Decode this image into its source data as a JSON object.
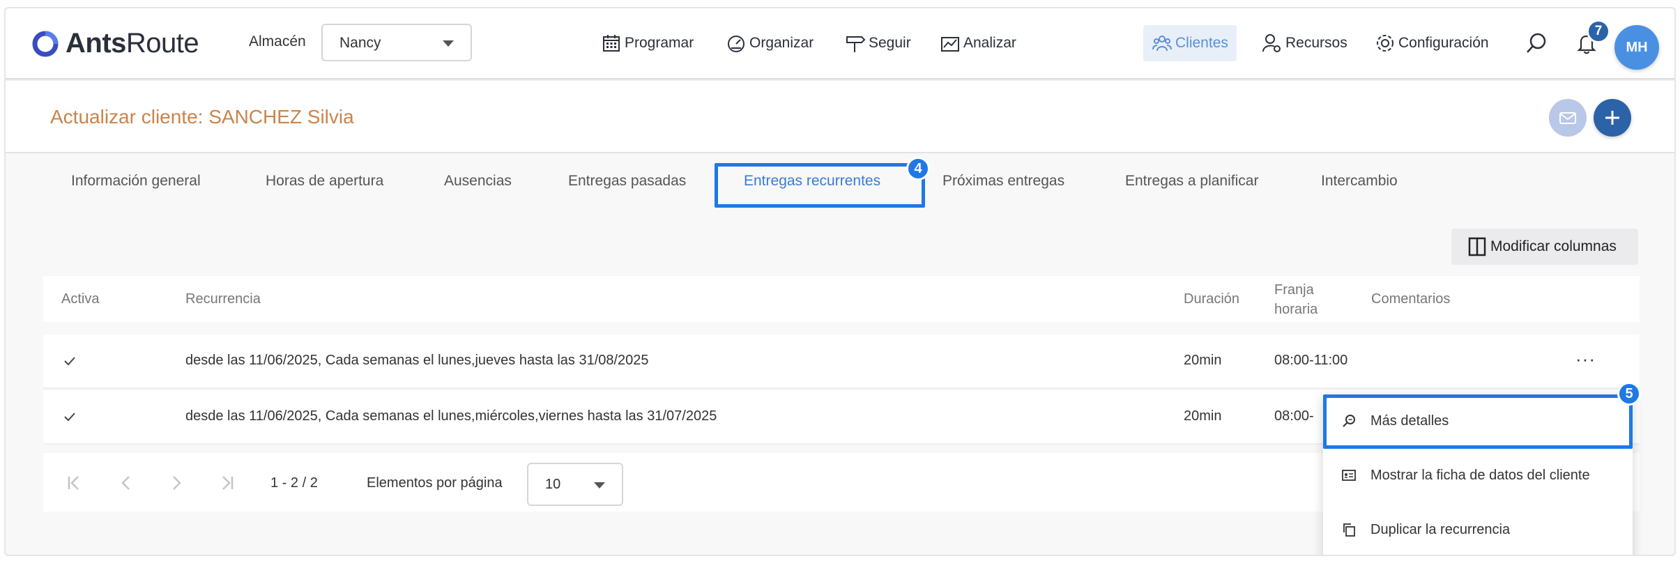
{
  "header": {
    "logo": {
      "bold": "Ants",
      "light": "Route"
    },
    "warehouse_label": "Almacén",
    "warehouse_value": "Nancy",
    "nav": [
      {
        "label": "Programar",
        "icon": "calendar-icon"
      },
      {
        "label": "Organizar",
        "icon": "gauge-icon"
      },
      {
        "label": "Seguir",
        "icon": "signpost-icon"
      },
      {
        "label": "Analizar",
        "icon": "chart-icon"
      },
      {
        "label": "Clientes",
        "icon": "people-icon",
        "active": true
      },
      {
        "label": "Recursos",
        "icon": "user-gear-icon"
      },
      {
        "label": "Configuración",
        "icon": "gear-icon"
      }
    ],
    "notification_count": "7",
    "avatar_initials": "MH"
  },
  "page": {
    "title": "Actualizar cliente: SANCHEZ Silvia"
  },
  "tabs": [
    {
      "label": "Información general"
    },
    {
      "label": "Horas de apertura"
    },
    {
      "label": "Ausencias"
    },
    {
      "label": "Entregas pasadas"
    },
    {
      "label": "Entregas recurrentes",
      "active": true
    },
    {
      "label": "Próximas entregas"
    },
    {
      "label": "Entregas a planificar"
    },
    {
      "label": "Intercambio"
    }
  ],
  "annotations": {
    "tab_step": "4",
    "menu_step": "5"
  },
  "toolbar": {
    "columns_button": "Modificar columnas"
  },
  "table": {
    "headers": {
      "activa": "Activa",
      "recurrencia": "Recurrencia",
      "duracion": "Duración",
      "franja_line1": "Franja",
      "franja_line2": "horaria",
      "comentarios": "Comentarios"
    },
    "rows": [
      {
        "activa": true,
        "recurrencia": "desde las 11/06/2025, Cada semanas el lunes,jueves hasta las 31/08/2025",
        "duracion": "20min",
        "franja": "08:00-11:00",
        "comentarios": ""
      },
      {
        "activa": true,
        "recurrencia": "desde las 11/06/2025, Cada semanas el lunes,miércoles,viernes hasta las 31/07/2025",
        "duracion": "20min",
        "franja": "08:00-",
        "comentarios": ""
      }
    ],
    "row_menu_label": "···"
  },
  "pagination": {
    "range": "1 - 2 / 2",
    "per_page_label": "Elementos por página",
    "per_page_value": "10"
  },
  "context_menu": {
    "items": [
      {
        "label": "Más detalles",
        "icon": "zoom-icon"
      },
      {
        "label": "Mostrar la ficha de datos del cliente",
        "icon": "id-card-icon"
      },
      {
        "label": "Duplicar la recurrencia",
        "icon": "copy-icon"
      }
    ]
  },
  "colors": {
    "accent": "#2c62a8",
    "highlight": "#1f78e6",
    "title": "#c9844a",
    "active_tab": "#3a7bd5"
  }
}
